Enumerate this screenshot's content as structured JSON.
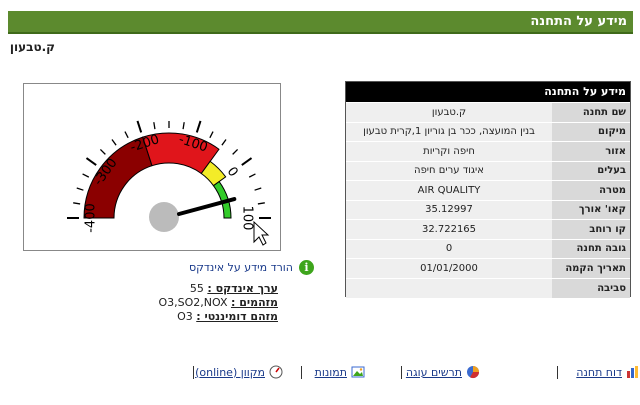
{
  "header": {
    "title": "מידע על התחנה"
  },
  "station": {
    "name": "ק.טבעון"
  },
  "gauge": {
    "ticks": [
      "-400",
      "-300",
      "-200",
      "-100",
      "0",
      "100"
    ],
    "needle_value": 55,
    "min": -400,
    "max": 100,
    "colors": {
      "dark_red": "#8b0000",
      "red": "#e0151b",
      "yellow": "#f3ec28",
      "green": "#33cc2a",
      "hub": "#bbbbbb"
    }
  },
  "info_panel": {
    "title": "מידע על התחנה",
    "rows": [
      {
        "label": "שם תחנה",
        "value": "ק.טבעון"
      },
      {
        "label": "מיקום",
        "value": "בנין המועצה, ככר בן גוריון 1,קרית טבעון"
      },
      {
        "label": "אזור",
        "value": "חיפה וקריות"
      },
      {
        "label": "בעלים",
        "value": "איגוד ערים חיפה"
      },
      {
        "label": "מטרה",
        "value": "AIR QUALITY"
      },
      {
        "label": "קאו' אורך",
        "value": "35.12997"
      },
      {
        "label": "קו רוחב",
        "value": "32.722165"
      },
      {
        "label": "גובה תחנה",
        "value": "0"
      },
      {
        "label": "תאריך הקמה",
        "value": "01/01/2000"
      },
      {
        "label": "סביבה",
        "value": ""
      }
    ]
  },
  "download": {
    "label": "הורד מידע על אינדקס",
    "icon": "info-icon"
  },
  "index_info": {
    "value_label": "ערך אינדקס :",
    "value": "55",
    "pollutants_label": "מזהמים :",
    "pollutants": "O3,SO2,NOX",
    "dominant_label": "מזהם דומיננטי :",
    "dominant": "O3"
  },
  "footer": {
    "report": "דוח תחנה",
    "chart": "תרשים עוגה",
    "images": "תמונות",
    "online": "מקוון (online)"
  }
}
